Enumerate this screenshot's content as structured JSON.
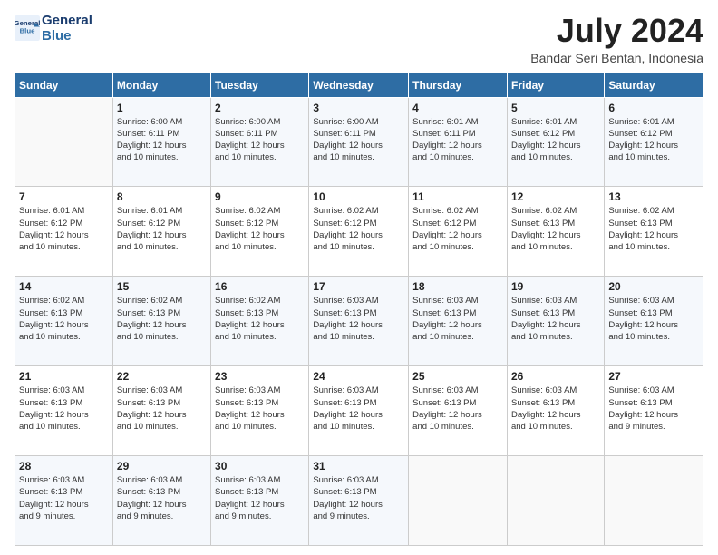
{
  "logo": {
    "line1": "General",
    "line2": "Blue"
  },
  "title": "July 2024",
  "location": "Bandar Seri Bentan, Indonesia",
  "days_header": [
    "Sunday",
    "Monday",
    "Tuesday",
    "Wednesday",
    "Thursday",
    "Friday",
    "Saturday"
  ],
  "weeks": [
    [
      {
        "day": "",
        "info": ""
      },
      {
        "day": "1",
        "info": "Sunrise: 6:00 AM\nSunset: 6:11 PM\nDaylight: 12 hours\nand 10 minutes."
      },
      {
        "day": "2",
        "info": "Sunrise: 6:00 AM\nSunset: 6:11 PM\nDaylight: 12 hours\nand 10 minutes."
      },
      {
        "day": "3",
        "info": "Sunrise: 6:00 AM\nSunset: 6:11 PM\nDaylight: 12 hours\nand 10 minutes."
      },
      {
        "day": "4",
        "info": "Sunrise: 6:01 AM\nSunset: 6:11 PM\nDaylight: 12 hours\nand 10 minutes."
      },
      {
        "day": "5",
        "info": "Sunrise: 6:01 AM\nSunset: 6:12 PM\nDaylight: 12 hours\nand 10 minutes."
      },
      {
        "day": "6",
        "info": "Sunrise: 6:01 AM\nSunset: 6:12 PM\nDaylight: 12 hours\nand 10 minutes."
      }
    ],
    [
      {
        "day": "7",
        "info": "Sunrise: 6:01 AM\nSunset: 6:12 PM\nDaylight: 12 hours\nand 10 minutes."
      },
      {
        "day": "8",
        "info": "Sunrise: 6:01 AM\nSunset: 6:12 PM\nDaylight: 12 hours\nand 10 minutes."
      },
      {
        "day": "9",
        "info": "Sunrise: 6:02 AM\nSunset: 6:12 PM\nDaylight: 12 hours\nand 10 minutes."
      },
      {
        "day": "10",
        "info": "Sunrise: 6:02 AM\nSunset: 6:12 PM\nDaylight: 12 hours\nand 10 minutes."
      },
      {
        "day": "11",
        "info": "Sunrise: 6:02 AM\nSunset: 6:12 PM\nDaylight: 12 hours\nand 10 minutes."
      },
      {
        "day": "12",
        "info": "Sunrise: 6:02 AM\nSunset: 6:13 PM\nDaylight: 12 hours\nand 10 minutes."
      },
      {
        "day": "13",
        "info": "Sunrise: 6:02 AM\nSunset: 6:13 PM\nDaylight: 12 hours\nand 10 minutes."
      }
    ],
    [
      {
        "day": "14",
        "info": "Sunrise: 6:02 AM\nSunset: 6:13 PM\nDaylight: 12 hours\nand 10 minutes."
      },
      {
        "day": "15",
        "info": "Sunrise: 6:02 AM\nSunset: 6:13 PM\nDaylight: 12 hours\nand 10 minutes."
      },
      {
        "day": "16",
        "info": "Sunrise: 6:02 AM\nSunset: 6:13 PM\nDaylight: 12 hours\nand 10 minutes."
      },
      {
        "day": "17",
        "info": "Sunrise: 6:03 AM\nSunset: 6:13 PM\nDaylight: 12 hours\nand 10 minutes."
      },
      {
        "day": "18",
        "info": "Sunrise: 6:03 AM\nSunset: 6:13 PM\nDaylight: 12 hours\nand 10 minutes."
      },
      {
        "day": "19",
        "info": "Sunrise: 6:03 AM\nSunset: 6:13 PM\nDaylight: 12 hours\nand 10 minutes."
      },
      {
        "day": "20",
        "info": "Sunrise: 6:03 AM\nSunset: 6:13 PM\nDaylight: 12 hours\nand 10 minutes."
      }
    ],
    [
      {
        "day": "21",
        "info": "Sunrise: 6:03 AM\nSunset: 6:13 PM\nDaylight: 12 hours\nand 10 minutes."
      },
      {
        "day": "22",
        "info": "Sunrise: 6:03 AM\nSunset: 6:13 PM\nDaylight: 12 hours\nand 10 minutes."
      },
      {
        "day": "23",
        "info": "Sunrise: 6:03 AM\nSunset: 6:13 PM\nDaylight: 12 hours\nand 10 minutes."
      },
      {
        "day": "24",
        "info": "Sunrise: 6:03 AM\nSunset: 6:13 PM\nDaylight: 12 hours\nand 10 minutes."
      },
      {
        "day": "25",
        "info": "Sunrise: 6:03 AM\nSunset: 6:13 PM\nDaylight: 12 hours\nand 10 minutes."
      },
      {
        "day": "26",
        "info": "Sunrise: 6:03 AM\nSunset: 6:13 PM\nDaylight: 12 hours\nand 10 minutes."
      },
      {
        "day": "27",
        "info": "Sunrise: 6:03 AM\nSunset: 6:13 PM\nDaylight: 12 hours\nand 9 minutes."
      }
    ],
    [
      {
        "day": "28",
        "info": "Sunrise: 6:03 AM\nSunset: 6:13 PM\nDaylight: 12 hours\nand 9 minutes."
      },
      {
        "day": "29",
        "info": "Sunrise: 6:03 AM\nSunset: 6:13 PM\nDaylight: 12 hours\nand 9 minutes."
      },
      {
        "day": "30",
        "info": "Sunrise: 6:03 AM\nSunset: 6:13 PM\nDaylight: 12 hours\nand 9 minutes."
      },
      {
        "day": "31",
        "info": "Sunrise: 6:03 AM\nSunset: 6:13 PM\nDaylight: 12 hours\nand 9 minutes."
      },
      {
        "day": "",
        "info": ""
      },
      {
        "day": "",
        "info": ""
      },
      {
        "day": "",
        "info": ""
      }
    ]
  ]
}
